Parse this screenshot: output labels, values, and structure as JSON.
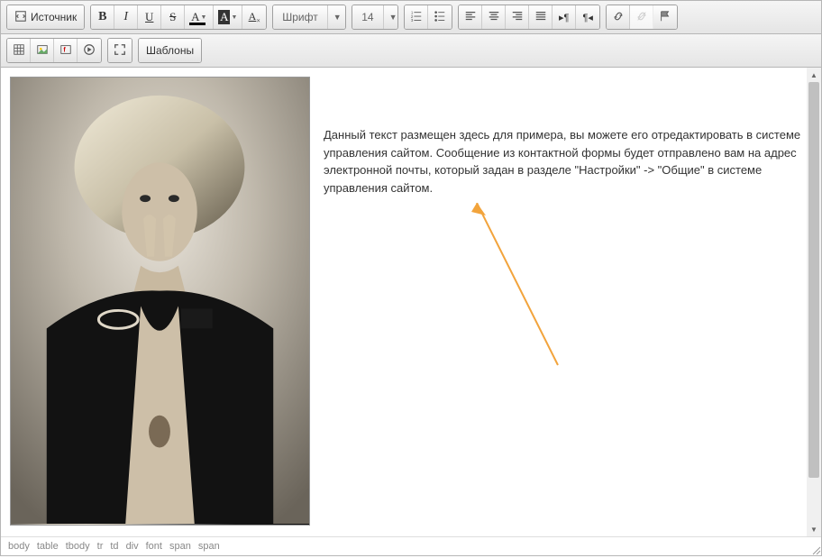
{
  "toolbar": {
    "row1": {
      "source_label": "Источник",
      "font_label": "Шрифт",
      "fontsize_label": "14"
    },
    "row2": {
      "templates_label": "Шаблоны"
    }
  },
  "content": {
    "text": "Данный текст размещен здесь для примера, вы можете его отредактировать в системе управления сайтом. Сообщение из контактной формы будет отправлено вам на адрес электронной почты, который задан в разделе \"Настройки\" -> \"Общие\" в системе управления сайтом."
  },
  "breadcrumb": {
    "items": [
      "body",
      "table",
      "tbody",
      "tr",
      "td",
      "div",
      "font",
      "span",
      "span"
    ]
  },
  "colors": {
    "arrow": "#f2a43c"
  }
}
